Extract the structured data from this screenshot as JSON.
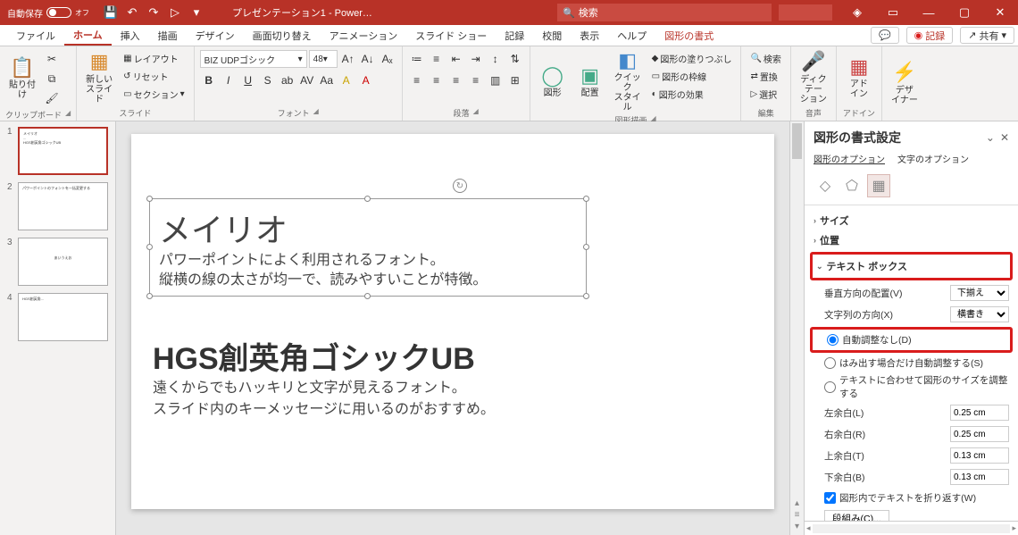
{
  "titlebar": {
    "autosave": "自動保存",
    "autosave_state": "オフ",
    "title": "プレゼンテーション1 - Power…",
    "search_placeholder": "検索"
  },
  "tabs": [
    "ファイル",
    "ホーム",
    "挿入",
    "描画",
    "デザイン",
    "画面切り替え",
    "アニメーション",
    "スライド ショー",
    "記録",
    "校閲",
    "表示",
    "ヘルプ",
    "図形の書式"
  ],
  "tab_right": {
    "comment": "",
    "record": "記録",
    "share": "共有"
  },
  "ribbon": {
    "clipboard": {
      "paste": "貼り付け",
      "label": "クリップボード"
    },
    "slides": {
      "new": "新しい\nスライド",
      "layout": "レイアウト",
      "reset": "リセット",
      "section": "セクション",
      "label": "スライド"
    },
    "font": {
      "name": "BIZ UDPゴシック",
      "size": "48",
      "label": "フォント"
    },
    "para": {
      "label": "段落"
    },
    "drawing": {
      "shape": "図形",
      "arrange": "配置",
      "quick": "クイック\nスタイル",
      "fill": "図形の塗りつぶし",
      "outline": "図形の枠線",
      "effects": "図形の効果",
      "label": "図形描画"
    },
    "editing": {
      "find": "検索",
      "replace": "置換",
      "select": "選択",
      "label": "編集"
    },
    "voice": {
      "dictate": "ディクテー\nション",
      "label": "音声"
    },
    "addins": {
      "addin": "アド\nイン",
      "label": "アドイン"
    },
    "designer": {
      "designer": "デザ\nイナー"
    }
  },
  "thumbs": [
    {
      "n": "1",
      "lines": [
        "メイリオ",
        "...",
        "HGS創英角ゴシックUB",
        "..."
      ]
    },
    {
      "n": "2",
      "lines": [
        "パワーポイントのフォントを一括変更する"
      ]
    },
    {
      "n": "3",
      "lines": [
        "",
        "あいうえお"
      ]
    },
    {
      "n": "4",
      "lines": [
        "HGS創英角...",
        "",
        "...一括変更..."
      ]
    }
  ],
  "slide": {
    "box1": {
      "title": "メイリオ",
      "l1": "パワーポイントによく利用されるフォント。",
      "l2": "縦横の線の太さが均一で、読みやすいことが特徴。"
    },
    "box2": {
      "title": "HGS創英角ゴシックUB",
      "l1": "遠くからでもハッキリと文字が見えるフォント。",
      "l2": "スライド内のキーメッセージに用いるのがおすすめ。"
    }
  },
  "pane": {
    "title": "図形の書式設定",
    "sub_shape": "図形のオプション",
    "sub_text": "文字のオプション",
    "sections": {
      "size": "サイズ",
      "position": "位置",
      "textbox": "テキスト ボックス"
    },
    "valign_label": "垂直方向の配置(V)",
    "valign": "下揃え",
    "dir_label": "文字列の方向(X)",
    "dir": "横書き",
    "r1": "自動調整なし(D)",
    "r2": "はみ出す場合だけ自動調整する(S)",
    "r3": "テキストに合わせて図形のサイズを調整する",
    "left_label": "左余白(L)",
    "left": "0.25 cm",
    "right_label": "右余白(R)",
    "right": "0.25 cm",
    "top_label": "上余白(T)",
    "top": "0.13 cm",
    "bottom_label": "下余白(B)",
    "bottom": "0.13 cm",
    "wrap": "図形内でテキストを折り返す(W)",
    "columns": "段組み(C)..."
  }
}
